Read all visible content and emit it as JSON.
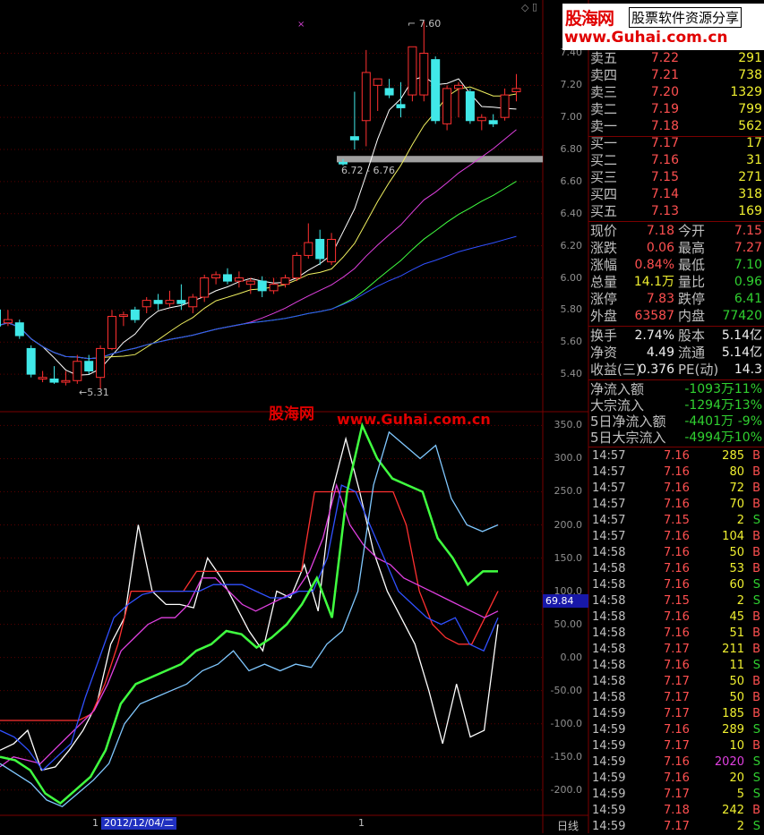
{
  "logo": {
    "brand_cn": "股海网",
    "tagline": "股票软件资源分享",
    "url": "www.Guhai.com.cn"
  },
  "watermark": {
    "brand": "股海网",
    "url": "www.Guhai.com.cn"
  },
  "price_axis": [
    "7.40",
    "7.20",
    "7.00",
    "6.80",
    "6.60",
    "6.40",
    "6.20",
    "6.00",
    "5.80",
    "5.60",
    "5.40"
  ],
  "indicator_axis": [
    "350.0",
    "300.0",
    "250.0",
    "200.0",
    "150.0",
    "100.0",
    "50.00",
    "0.00",
    "-50.00",
    "-100.0",
    "-150.0",
    "-200.0"
  ],
  "annotations": {
    "high": "7.60",
    "low": "5.31",
    "gap": "6.72 - 6.76"
  },
  "indicator_value": "69.84",
  "date_label": "2012/12/04/二",
  "period_label": "日线",
  "bottom_marks": [
    "1",
    "1"
  ],
  "order_book": [
    {
      "label": "卖五",
      "price": "7.22",
      "vol": "291"
    },
    {
      "label": "卖四",
      "price": "7.21",
      "vol": "738"
    },
    {
      "label": "卖三",
      "price": "7.20",
      "vol": "1329"
    },
    {
      "label": "卖二",
      "price": "7.19",
      "vol": "799"
    },
    {
      "label": "卖一",
      "price": "7.18",
      "vol": "562"
    },
    {
      "label": "买一",
      "price": "7.17",
      "vol": "17"
    },
    {
      "label": "买二",
      "price": "7.16",
      "vol": "31"
    },
    {
      "label": "买三",
      "price": "7.15",
      "vol": "271"
    },
    {
      "label": "买四",
      "price": "7.14",
      "vol": "318"
    },
    {
      "label": "买五",
      "price": "7.13",
      "vol": "169"
    }
  ],
  "quote": [
    {
      "l1": "现价",
      "v1": "7.18",
      "c1": "#ff5050",
      "l2": "今开",
      "v2": "7.15",
      "c2": "#ff5050"
    },
    {
      "l1": "涨跌",
      "v1": "0.06",
      "c1": "#ff5050",
      "l2": "最高",
      "v2": "7.27",
      "c2": "#ff5050"
    },
    {
      "l1": "涨幅",
      "v1": "0.84%",
      "c1": "#ff5050",
      "l2": "最低",
      "v2": "7.10",
      "c2": "#30d030"
    },
    {
      "l1": "总量",
      "v1": "14.1万",
      "c1": "#f0f030",
      "l2": "量比",
      "v2": "0.96",
      "c2": "#30d030"
    },
    {
      "l1": "涨停",
      "v1": "7.83",
      "c1": "#ff5050",
      "l2": "跌停",
      "v2": "6.41",
      "c2": "#30d030"
    },
    {
      "l1": "外盘",
      "v1": "63587",
      "c1": "#ff5050",
      "l2": "内盘",
      "v2": "77420",
      "c2": "#30d030"
    }
  ],
  "quote2": [
    {
      "l1": "换手",
      "v1": "2.74%",
      "l2": "股本",
      "v2": "5.14亿"
    },
    {
      "l1": "净资",
      "v1": "4.49",
      "l2": "流通",
      "v2": "5.14亿"
    },
    {
      "l1": "收益(三)",
      "v1": "0.376",
      "l2": "PE(动)",
      "v2": "14.3"
    }
  ],
  "flows": [
    {
      "label": "净流入额",
      "value": "-1093万",
      "pct": "-11%"
    },
    {
      "label": "大宗流入",
      "value": "-1294万",
      "pct": "-13%"
    },
    {
      "label": "5日净流入额",
      "value": "-4401万",
      "pct": "-9%"
    },
    {
      "label": "5日大宗流入",
      "value": "-4994万",
      "pct": "-10%"
    }
  ],
  "trades": [
    {
      "time": "14:57",
      "price": "7.16",
      "pc": "#ff5050",
      "vol": "285",
      "vc": "#f0f030",
      "side": "B"
    },
    {
      "time": "14:57",
      "price": "7.16",
      "pc": "#ff5050",
      "vol": "80",
      "vc": "#f0f030",
      "side": "B"
    },
    {
      "time": "14:57",
      "price": "7.16",
      "pc": "#ff5050",
      "vol": "72",
      "vc": "#f0f030",
      "side": "B"
    },
    {
      "time": "14:57",
      "price": "7.16",
      "pc": "#ff5050",
      "vol": "70",
      "vc": "#f0f030",
      "side": "B"
    },
    {
      "time": "14:57",
      "price": "7.15",
      "pc": "#ff5050",
      "vol": "2",
      "vc": "#f0f030",
      "side": "S"
    },
    {
      "time": "14:57",
      "price": "7.16",
      "pc": "#ff5050",
      "vol": "104",
      "vc": "#f0f030",
      "side": "B"
    },
    {
      "time": "14:58",
      "price": "7.16",
      "pc": "#ff5050",
      "vol": "50",
      "vc": "#f0f030",
      "side": "B"
    },
    {
      "time": "14:58",
      "price": "7.16",
      "pc": "#ff5050",
      "vol": "53",
      "vc": "#f0f030",
      "side": "B"
    },
    {
      "time": "14:58",
      "price": "7.16",
      "pc": "#ff5050",
      "vol": "60",
      "vc": "#f0f030",
      "side": "S"
    },
    {
      "time": "14:58",
      "price": "7.15",
      "pc": "#ff5050",
      "vol": "2",
      "vc": "#f0f030",
      "side": "S"
    },
    {
      "time": "14:58",
      "price": "7.16",
      "pc": "#ff5050",
      "vol": "45",
      "vc": "#f0f030",
      "side": "B"
    },
    {
      "time": "14:58",
      "price": "7.16",
      "pc": "#ff5050",
      "vol": "51",
      "vc": "#f0f030",
      "side": "B"
    },
    {
      "time": "14:58",
      "price": "7.17",
      "pc": "#ff5050",
      "vol": "211",
      "vc": "#f0f030",
      "side": "B"
    },
    {
      "time": "14:58",
      "price": "7.16",
      "pc": "#ff5050",
      "vol": "11",
      "vc": "#f0f030",
      "side": "S"
    },
    {
      "time": "14:58",
      "price": "7.17",
      "pc": "#ff5050",
      "vol": "50",
      "vc": "#f0f030",
      "side": "B"
    },
    {
      "time": "14:58",
      "price": "7.17",
      "pc": "#ff5050",
      "vol": "50",
      "vc": "#f0f030",
      "side": "B"
    },
    {
      "time": "14:59",
      "price": "7.17",
      "pc": "#ff5050",
      "vol": "185",
      "vc": "#f0f030",
      "side": "B"
    },
    {
      "time": "14:59",
      "price": "7.16",
      "pc": "#ff5050",
      "vol": "289",
      "vc": "#f0f030",
      "side": "S"
    },
    {
      "time": "14:59",
      "price": "7.17",
      "pc": "#ff5050",
      "vol": "10",
      "vc": "#f0f030",
      "side": "B"
    },
    {
      "time": "14:59",
      "price": "7.16",
      "pc": "#ff5050",
      "vol": "2020",
      "vc": "#e040e0",
      "side": "S"
    },
    {
      "time": "14:59",
      "price": "7.16",
      "pc": "#ff5050",
      "vol": "20",
      "vc": "#f0f030",
      "side": "S"
    },
    {
      "time": "14:59",
      "price": "7.17",
      "pc": "#ff5050",
      "vol": "5",
      "vc": "#f0f030",
      "side": "S"
    },
    {
      "time": "14:59",
      "price": "7.18",
      "pc": "#ff5050",
      "vol": "242",
      "vc": "#f0f030",
      "side": "B"
    },
    {
      "time": "14:59",
      "price": "7.17",
      "pc": "#ff5050",
      "vol": "2",
      "vc": "#f0f030",
      "side": "S"
    }
  ],
  "chart_data": [
    {
      "type": "candlestick",
      "title": "",
      "ylim": [
        5.25,
        7.62
      ],
      "candles": [
        {
          "o": 5.8,
          "h": 5.86,
          "l": 5.64,
          "c": 5.7
        },
        {
          "o": 5.72,
          "h": 5.8,
          "l": 5.7,
          "c": 5.74
        },
        {
          "o": 5.72,
          "h": 5.74,
          "l": 5.62,
          "c": 5.64
        },
        {
          "o": 5.56,
          "h": 5.58,
          "l": 5.38,
          "c": 5.4
        },
        {
          "o": 5.37,
          "h": 5.42,
          "l": 5.35,
          "c": 5.38
        },
        {
          "o": 5.37,
          "h": 5.45,
          "l": 5.34,
          "c": 5.35
        },
        {
          "o": 5.35,
          "h": 5.42,
          "l": 5.33,
          "c": 5.36
        },
        {
          "o": 5.36,
          "h": 5.52,
          "l": 5.34,
          "c": 5.48
        },
        {
          "o": 5.48,
          "h": 5.52,
          "l": 5.4,
          "c": 5.42
        },
        {
          "o": 5.38,
          "h": 5.58,
          "l": 5.31,
          "c": 5.56
        },
        {
          "o": 5.56,
          "h": 5.8,
          "l": 5.55,
          "c": 5.76
        },
        {
          "o": 5.76,
          "h": 5.79,
          "l": 5.7,
          "c": 5.77
        },
        {
          "o": 5.8,
          "h": 5.82,
          "l": 5.72,
          "c": 5.74
        },
        {
          "o": 5.82,
          "h": 5.88,
          "l": 5.78,
          "c": 5.86
        },
        {
          "o": 5.86,
          "h": 5.9,
          "l": 5.8,
          "c": 5.84
        },
        {
          "o": 5.84,
          "h": 5.92,
          "l": 5.82,
          "c": 5.86
        },
        {
          "o": 5.86,
          "h": 5.96,
          "l": 5.8,
          "c": 5.84
        },
        {
          "o": 5.82,
          "h": 5.9,
          "l": 5.78,
          "c": 5.88
        },
        {
          "o": 5.88,
          "h": 6.02,
          "l": 5.85,
          "c": 6.0
        },
        {
          "o": 6.0,
          "h": 6.04,
          "l": 5.96,
          "c": 6.02
        },
        {
          "o": 6.02,
          "h": 6.06,
          "l": 5.96,
          "c": 5.98
        },
        {
          "o": 5.98,
          "h": 6.04,
          "l": 5.94,
          "c": 6.0
        },
        {
          "o": 5.96,
          "h": 6.0,
          "l": 5.9,
          "c": 5.98
        },
        {
          "o": 5.98,
          "h": 6.01,
          "l": 5.88,
          "c": 5.92
        },
        {
          "o": 5.92,
          "h": 6.0,
          "l": 5.9,
          "c": 5.96
        },
        {
          "o": 5.96,
          "h": 6.02,
          "l": 5.94,
          "c": 6.0
        },
        {
          "o": 6.0,
          "h": 6.16,
          "l": 5.98,
          "c": 6.14
        },
        {
          "o": 6.14,
          "h": 6.34,
          "l": 6.12,
          "c": 6.22
        },
        {
          "o": 6.24,
          "h": 6.3,
          "l": 6.08,
          "c": 6.12
        },
        {
          "o": 6.1,
          "h": 6.28,
          "l": 6.08,
          "c": 6.24
        },
        {
          "o": 6.72,
          "h": 6.74,
          "l": 6.7,
          "c": 6.71
        },
        {
          "o": 6.88,
          "h": 7.16,
          "l": 6.8,
          "c": 6.86
        },
        {
          "o": 6.98,
          "h": 7.42,
          "l": 6.82,
          "c": 7.28
        },
        {
          "o": 7.2,
          "h": 7.22,
          "l": 7.04,
          "c": 7.24
        },
        {
          "o": 7.18,
          "h": 7.24,
          "l": 7.12,
          "c": 7.14
        },
        {
          "o": 7.08,
          "h": 7.22,
          "l": 7.0,
          "c": 7.06
        },
        {
          "o": 7.14,
          "h": 7.44,
          "l": 7.1,
          "c": 7.44
        },
        {
          "o": 7.14,
          "h": 7.6,
          "l": 7.1,
          "c": 7.4
        },
        {
          "o": 7.36,
          "h": 7.38,
          "l": 6.96,
          "c": 6.98
        },
        {
          "o": 6.96,
          "h": 7.2,
          "l": 6.92,
          "c": 7.18
        },
        {
          "o": 7.18,
          "h": 7.22,
          "l": 7.0,
          "c": 7.2
        },
        {
          "o": 7.16,
          "h": 7.18,
          "l": 6.96,
          "c": 6.98
        },
        {
          "o": 6.98,
          "h": 7.02,
          "l": 6.92,
          "c": 7.0
        },
        {
          "o": 6.98,
          "h": 7.02,
          "l": 6.94,
          "c": 6.96
        },
        {
          "o": 7.0,
          "h": 7.18,
          "l": 6.98,
          "c": 7.14
        },
        {
          "o": 7.16,
          "h": 7.27,
          "l": 7.1,
          "c": 7.18
        }
      ]
    },
    {
      "type": "line",
      "title": "",
      "ylim": [
        -230,
        360
      ],
      "series": [
        {
          "color": "#ffffff",
          "values": [
            -140,
            -130,
            -110,
            -170,
            -165,
            -140,
            -110,
            -70,
            20,
            60,
            200,
            100,
            80,
            80,
            75,
            150,
            120,
            80,
            40,
            10,
            100,
            90,
            140,
            70,
            250,
            330,
            250,
            160,
            100,
            60,
            20,
            -50,
            -130,
            -40,
            -120,
            -110,
            50
          ]
        },
        {
          "color": "#ff3030",
          "values": [
            -95,
            -95,
            -95,
            -95,
            -95,
            -95,
            -95,
            -85,
            -40,
            20,
            100,
            100,
            100,
            100,
            100,
            130,
            130,
            130,
            130,
            130,
            130,
            130,
            130,
            130,
            250,
            250,
            250,
            250,
            250,
            250,
            250,
            200,
            100,
            50,
            30,
            20,
            20,
            60,
            100
          ]
        },
        {
          "color": "#e040e0",
          "values": [
            -165,
            -150,
            -155,
            -160,
            -140,
            -120,
            -100,
            -80,
            -40,
            10,
            30,
            50,
            60,
            60,
            80,
            120,
            120,
            100,
            80,
            70,
            80,
            90,
            100,
            130,
            180,
            260,
            200,
            170,
            150,
            140,
            120,
            110,
            100,
            90,
            80,
            70,
            60,
            70
          ]
        },
        {
          "color": "#3050ff",
          "values": [
            -110,
            -120,
            -140,
            -170,
            -150,
            -130,
            -60,
            0,
            60,
            80,
            95,
            100,
            100,
            100,
            100,
            110,
            110,
            110,
            100,
            90,
            90,
            100,
            100,
            150,
            260,
            250,
            200,
            150,
            100,
            80,
            60,
            50,
            60,
            20,
            10,
            60
          ]
        },
        {
          "color": "#40ff40",
          "values": [
            -150,
            -155,
            -170,
            -205,
            -220,
            -200,
            -180,
            -140,
            -70,
            -40,
            -30,
            -20,
            -10,
            10,
            20,
            40,
            35,
            15,
            30,
            50,
            80,
            120,
            60,
            250,
            350,
            300,
            270,
            260,
            250,
            180,
            150,
            110,
            130,
            130
          ]
        },
        {
          "color": "#80c8ff",
          "values": [
            -160,
            -175,
            -190,
            -215,
            -225,
            -205,
            -185,
            -160,
            -100,
            -70,
            -60,
            -50,
            -40,
            -20,
            -10,
            10,
            -20,
            -10,
            -20,
            -10,
            -15,
            20,
            40,
            100,
            260,
            340,
            320,
            300,
            320,
            240,
            200,
            190,
            200
          ]
        }
      ]
    }
  ]
}
